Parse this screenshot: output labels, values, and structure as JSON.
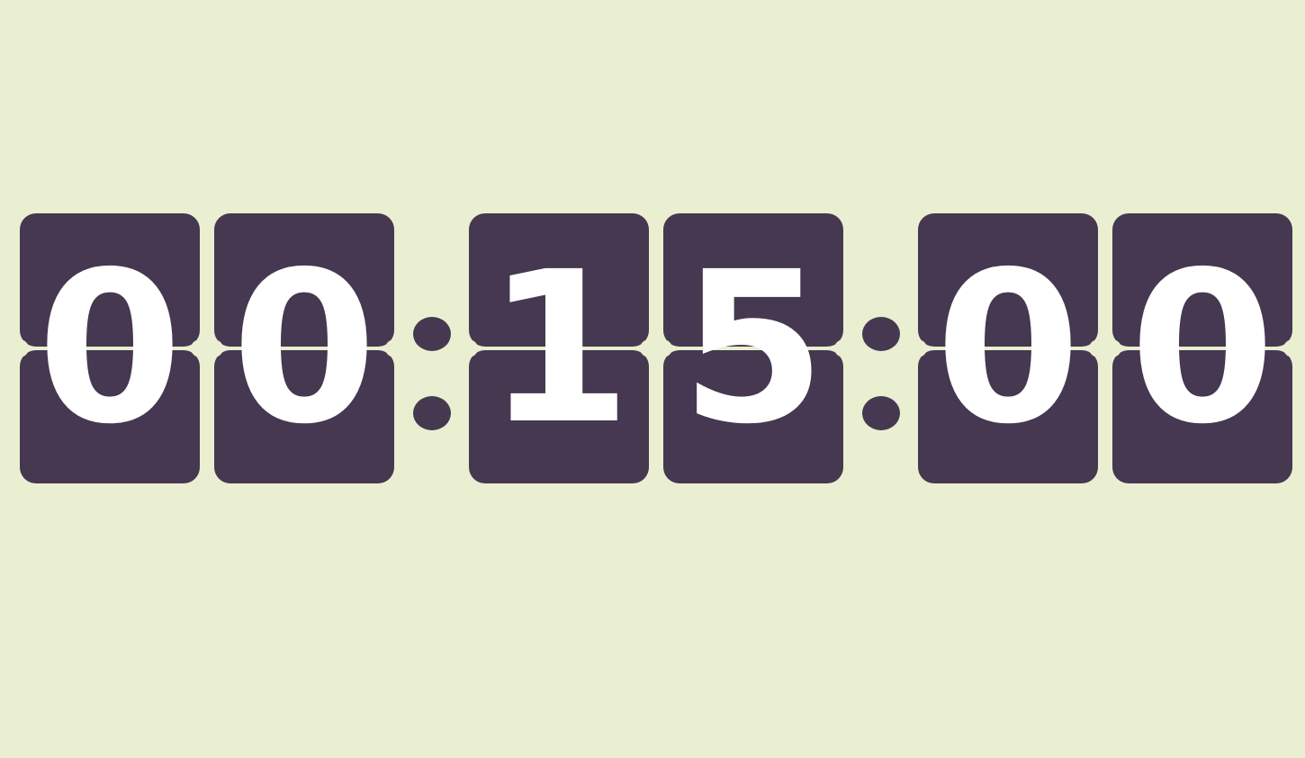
{
  "timer": {
    "hours": [
      "0",
      "0"
    ],
    "minutes": [
      "1",
      "5"
    ],
    "seconds": [
      "0",
      "0"
    ]
  },
  "colors": {
    "background": "#e9efd0",
    "card": "#453850",
    "digit_text": "#ffffff"
  }
}
